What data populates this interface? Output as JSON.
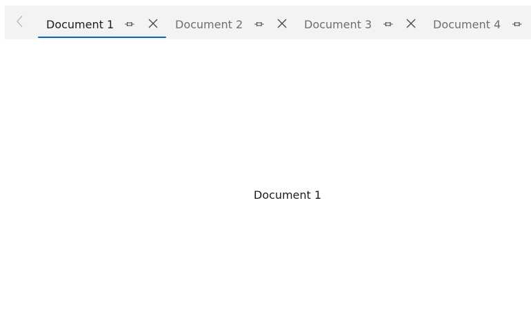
{
  "tabs": [
    {
      "label": "Document 1",
      "selected": true,
      "pin_icon": "pin-icon",
      "close_icon": "close-icon"
    },
    {
      "label": "Document 2",
      "selected": false,
      "pin_icon": "pin-icon",
      "close_icon": "close-icon"
    },
    {
      "label": "Document 3",
      "selected": false,
      "pin_icon": "pin-icon",
      "close_icon": "close-icon"
    },
    {
      "label": "Document 4",
      "selected": false,
      "pin_icon": "pin-icon"
    }
  ],
  "scroll_left_icon": "chevron-left-icon",
  "content": {
    "text": "Document 1"
  },
  "colors": {
    "tabstrip_background": "#f3f3f3",
    "selected_text": "#1b1b1b",
    "unselected_text": "#6e6e6e",
    "accent_underline": "#0067c0",
    "content_background": "#ffffff"
  }
}
